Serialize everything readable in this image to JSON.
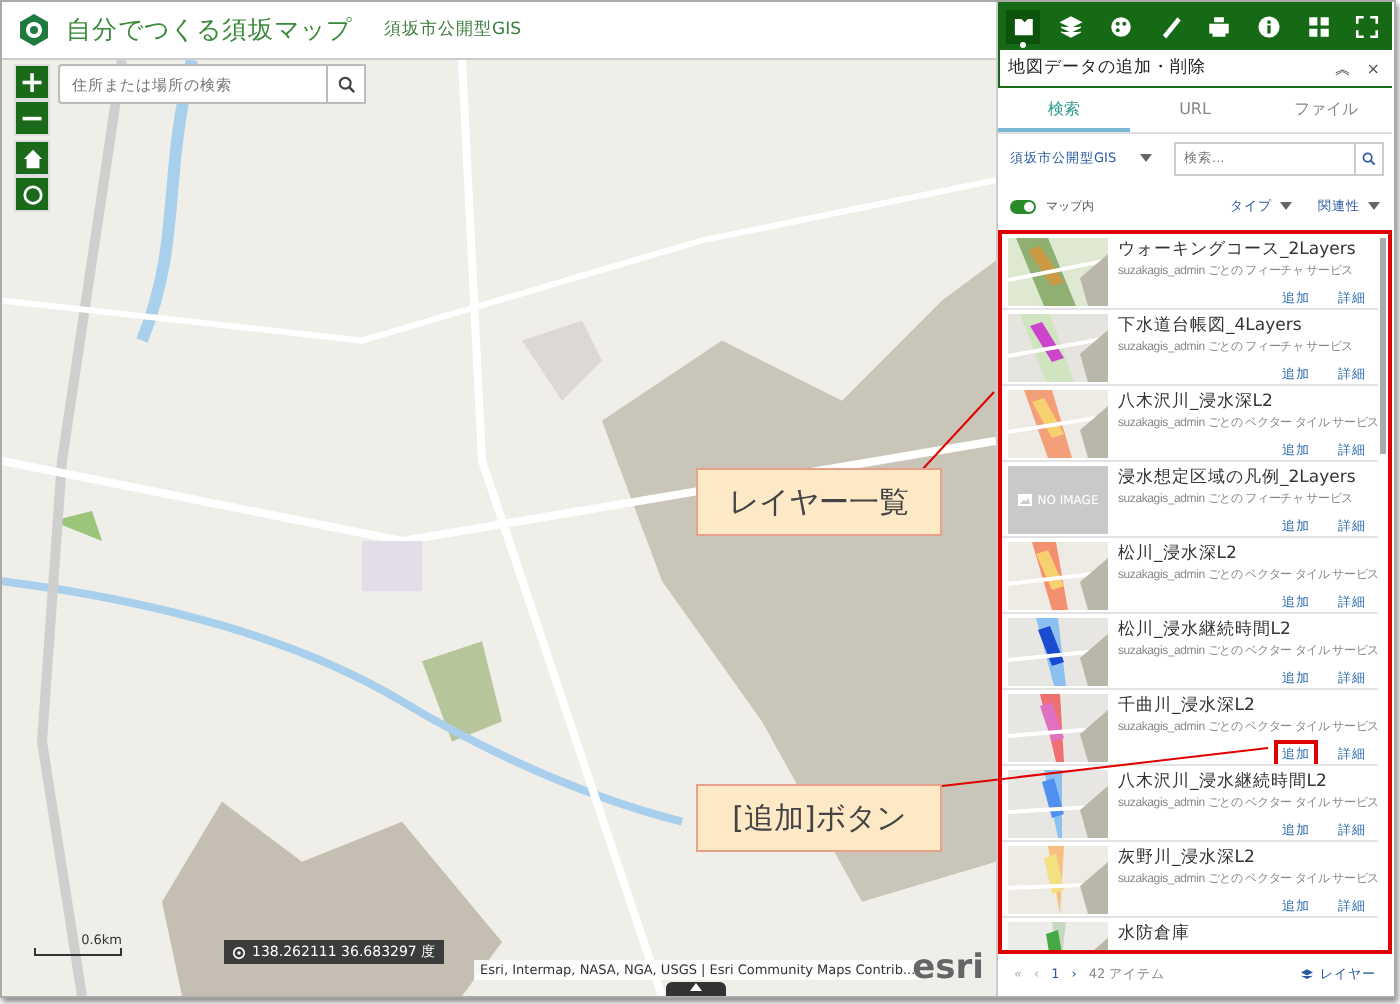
{
  "header": {
    "title": "自分でつくる須坂マップ",
    "subtitle": "須坂市公開型GIS"
  },
  "map": {
    "search": {
      "placeholder": "住所または場所の検索"
    },
    "zoom_in": "+",
    "zoom_out": "−",
    "scale": "0.6km",
    "coordinates": "138.262111 36.683297 度",
    "attribution": "Esri, Intermap, NASA, NGA, USGS | Esri Community Maps Contrib...",
    "logo": "esri"
  },
  "toolbar": [
    {
      "kind": "add-data",
      "selected": true
    },
    {
      "kind": "layers",
      "selected": false
    },
    {
      "kind": "palette",
      "selected": false
    },
    {
      "kind": "ruler",
      "selected": false
    },
    {
      "kind": "print",
      "selected": false
    },
    {
      "kind": "info",
      "selected": false
    },
    {
      "kind": "grid",
      "selected": false
    },
    {
      "kind": "fullscreen",
      "selected": false
    }
  ],
  "panel": {
    "title": "地図データの追加・削除",
    "collapse": "︽",
    "close": "×",
    "tabs": [
      {
        "label": "検索",
        "selected": true
      },
      {
        "label": "URL",
        "selected": false
      },
      {
        "label": "ファイル",
        "selected": false
      }
    ],
    "source": "須坂市公開型GIS",
    "search": {
      "placeholder": "検索..."
    },
    "map_extent": {
      "label": "マップ内",
      "on": true
    },
    "filters": [
      "タイプ",
      "関連性"
    ],
    "items": [
      {
        "title": "ウォーキングコース_2Layers",
        "owner": "suzakagis_admin ごとの フィーチャ サービス",
        "add": "追加",
        "details": "詳細",
        "highlighted": false
      },
      {
        "title": "下水道台帳図_4Layers",
        "owner": "suzakagis_admin ごとの フィーチャ サービス",
        "add": "追加",
        "details": "詳細",
        "highlighted": false
      },
      {
        "title": "八木沢川_浸水深L2",
        "owner": "suzakagis_admin ごとの ベクター タイル サービス",
        "add": "追加",
        "details": "詳細",
        "highlighted": false
      },
      {
        "title": "浸水想定区域の凡例_2Layers",
        "no_image": "NO IMAGE",
        "owner": "suzakagis_admin ごとの フィーチャ サービス",
        "add": "追加",
        "details": "詳細",
        "highlighted": false
      },
      {
        "title": "松川_浸水深L2",
        "owner": "suzakagis_admin ごとの ベクター タイル サービス",
        "add": "追加",
        "details": "詳細",
        "highlighted": false
      },
      {
        "title": "松川_浸水継続時間L2",
        "owner": "suzakagis_admin ごとの ベクター タイル サービス",
        "add": "追加",
        "details": "詳細",
        "highlighted": false
      },
      {
        "title": "千曲川_浸水深L2",
        "owner": "suzakagis_admin ごとの ベクター タイル サービス",
        "add": "追加",
        "details": "詳細",
        "highlighted": true
      },
      {
        "title": "八木沢川_浸水継続時間L2",
        "owner": "suzakagis_admin ごとの ベクター タイル サービス",
        "add": "追加",
        "details": "詳細",
        "highlighted": false
      },
      {
        "title": "灰野川_浸水深L2",
        "owner": "suzakagis_admin ごとの ベクター タイル サービス",
        "add": "追加",
        "details": "詳細",
        "highlighted": false
      },
      {
        "title": "水防倉庫"
      }
    ],
    "list_highlighted": true,
    "pager": {
      "first": "«",
      "prev": "‹",
      "page": "1",
      "next": "›",
      "count": "42 アイテム",
      "layers": "レイヤー"
    }
  },
  "callouts": [
    {
      "text": "レイヤー一覧"
    },
    {
      "text": "[追加]ボタン"
    }
  ]
}
